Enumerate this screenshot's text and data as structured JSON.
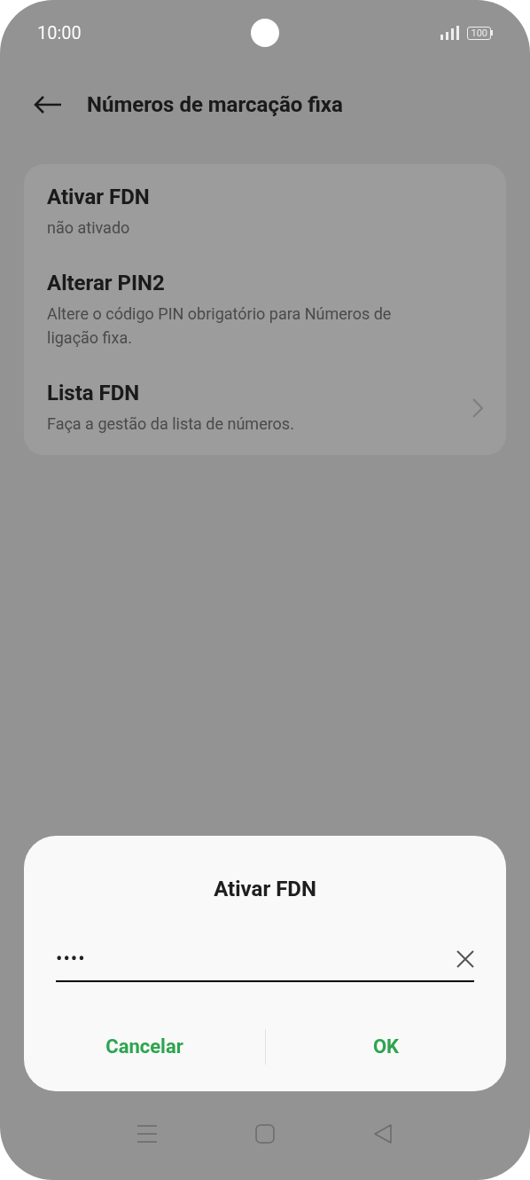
{
  "status_bar": {
    "time": "10:00",
    "battery": "100"
  },
  "header": {
    "title": "Números de marcação fixa"
  },
  "settings": [
    {
      "title": "Ativar FDN",
      "subtitle": "não ativado",
      "chevron": false
    },
    {
      "title": "Alterar PIN2",
      "subtitle": "Altere o código PIN obrigatório para Números de ligação fixa.",
      "chevron": false
    },
    {
      "title": "Lista FDN",
      "subtitle": "Faça a gestão da lista de números.",
      "chevron": true
    }
  ],
  "dialog": {
    "title": "Ativar FDN",
    "field": {
      "value": "••••"
    },
    "buttons": [
      "Cancelar",
      "OK"
    ]
  }
}
